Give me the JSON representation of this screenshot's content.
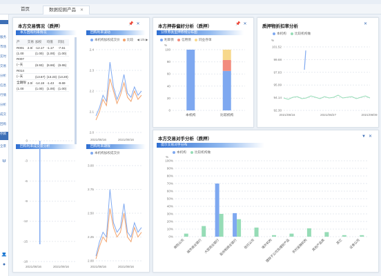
{
  "top_label": "",
  "tabs": [
    {
      "label": "首页"
    },
    {
      "label": "数据挖掘产品"
    }
  ],
  "sidebar": {
    "items": [
      "服务",
      "市场",
      "实时",
      "交易",
      "分析",
      "信息",
      "行情",
      "分析",
      "成交",
      "回购",
      "存款",
      "全景"
    ]
  },
  "panel1": {
    "title": "本方交易情况（质押）",
    "sub1": "本方回购利率情况",
    "sub2": "回购利率波动",
    "sub3": "回购利率成交量分析",
    "sub4": "回购利率期限",
    "table": {
      "header": [
        "产",
        "交易",
        "加权",
        "均值",
        "同比"
      ],
      "rows": [
        [
          "R001",
          "2.0/",
          "-12.17",
          "-1.17",
          "-7.61"
        ],
        [
          "(1.00",
          "",
          "(1.00)",
          "(1.00)",
          "(1.00)"
        ],
        [
          "R007",
          "",
          "",
          "",
          ""
        ],
        [
          "(--天",
          "",
          "(6.93)",
          "(6.66)",
          "(6.65)"
        ],
        [
          "R014",
          "",
          "",
          "",
          ""
        ],
        [
          "(--天",
          "",
          "(13.67)",
          "(13.23)",
          "(13.20)"
        ],
        [
          "全期限",
          "2.0/",
          "-14.18",
          "-1.43",
          "-9.69"
        ],
        [
          "(1.00",
          "",
          "(1.00)",
          "(1.00)",
          "(1.00)"
        ]
      ]
    },
    "legend_a": "本机构加权成交价",
    "legend_b": "比较",
    "page": "1/5",
    "chart_a_yticks": [
      "2.4",
      "2.3",
      "2.2",
      "2.1",
      "2.0"
    ],
    "chart_b_yticks": [
      "3.00",
      "2.75",
      "2.50",
      "2.25",
      "2.00"
    ],
    "left_yticks": [
      "0",
      "-3",
      "-6",
      "-9",
      "-12",
      "-15",
      "-18"
    ],
    "x_start": "2021/08/16",
    "x_end": "2021/09/16"
  },
  "panel2": {
    "title": "本方押券偏好分析（质押）",
    "sub": "分债券类型押券物分布图",
    "legend": [
      "利率债",
      "信用债",
      "同业存单"
    ],
    "unit": "%",
    "yticks": [
      "100",
      "80",
      "60",
      "40",
      "20",
      "0"
    ],
    "categories": [
      "本机构",
      "比较机构"
    ]
  },
  "panel3": {
    "title": "质押物折扣率分析",
    "legend": [
      "本机构",
      "比较机构做"
    ],
    "unit": "%",
    "yticks": [
      "101.52",
      "99.68",
      "97.83",
      "95.99",
      "94.14",
      "92.30"
    ],
    "xticks": [
      "2021/08/16",
      "2021/08/27",
      "2021/09/09"
    ]
  },
  "panel4": {
    "title": "本方交易对手分析（质押）",
    "sub": "提示交易对手分布",
    "legend": [
      "本机构",
      "比较机构做"
    ],
    "unit": "%",
    "yticks": [
      "100%",
      "90%",
      "80%",
      "70%",
      "60%",
      "50%",
      "40%",
      "30%",
      "20%",
      "10%",
      "0%"
    ],
    "categories": [
      "保险公司",
      "城市商业银行",
      "大型商业银行",
      "股份制商业银行",
      "信托公司",
      "境外机构",
      "理财子公司及理财产品",
      "农村金融机构",
      "其他产品类",
      "其它",
      "证券公司"
    ]
  },
  "chart_data": [
    {
      "type": "bar",
      "title": "分债券类型押券物分布图",
      "categories": [
        "本机构",
        "比较机构"
      ],
      "series": [
        {
          "name": "利率债",
          "values": [
            100,
            65
          ]
        },
        {
          "name": "信用债",
          "values": [
            0,
            18
          ]
        },
        {
          "name": "同业存单",
          "values": [
            0,
            17
          ]
        }
      ],
      "ylim": [
        0,
        100
      ],
      "colors": [
        "#7ea8f0",
        "#f28b7d",
        "#f7d88c"
      ]
    },
    {
      "type": "bar",
      "title": "提示交易对手分布",
      "categories": [
        "保险公司",
        "城市商业银行",
        "大型商业银行",
        "股份制商业银行",
        "信托公司",
        "境外机构",
        "理财子公司及理财产品",
        "农村金融机构",
        "其他产品类",
        "其它",
        "证券公司"
      ],
      "series": [
        {
          "name": "本机构",
          "values": [
            0,
            0,
            70,
            31,
            0,
            0,
            0,
            0,
            0,
            0,
            0
          ]
        },
        {
          "name": "比较机构做",
          "values": [
            4,
            14,
            30,
            23,
            12,
            2,
            4,
            11,
            6,
            2,
            2
          ]
        }
      ],
      "ylim": [
        0,
        100
      ],
      "colors": [
        "#7ea8f0",
        "#96dcb6"
      ]
    },
    {
      "type": "line",
      "title": "质押物折扣率分析",
      "x": [
        "2021/08/16",
        "2021/08/27",
        "2021/09/09"
      ],
      "series": [
        {
          "name": "本机构",
          "values": [
            98.2,
            101.0
          ]
        },
        {
          "name": "比较机构做",
          "values": [
            94.1,
            93.9,
            94.2,
            94.3,
            94.0,
            94.1,
            94.4,
            94.2,
            94.0,
            94.3,
            94.1,
            94.2,
            94.5,
            94.1,
            94.2,
            94.3,
            94.0,
            94.2,
            94.4,
            94.1
          ]
        }
      ],
      "ylim": [
        92.3,
        101.52
      ]
    },
    {
      "type": "line",
      "title": "回购利率波动",
      "series": [
        {
          "name": "本机构加权成交价",
          "values": [
            2.08,
            2.12,
            2.18,
            2.15,
            2.34,
            2.22,
            2.16,
            2.2,
            2.28,
            2.19,
            2.17,
            2.22,
            2.18,
            2.2
          ]
        },
        {
          "name": "比较",
          "values": [
            2.06,
            2.1,
            2.16,
            2.13,
            2.26,
            2.2,
            2.14,
            2.18,
            2.24,
            2.17,
            2.15,
            2.2,
            2.16,
            2.18
          ]
        }
      ],
      "ylim": [
        2.0,
        2.4
      ]
    },
    {
      "type": "line",
      "title": "回购利率期限",
      "series": [
        {
          "name": "本机构加权成交价",
          "values": [
            2.05,
            2.2,
            2.3,
            2.25,
            2.75,
            2.4,
            2.3,
            2.35,
            2.6,
            2.3,
            2.25,
            2.4,
            2.3,
            2.35
          ]
        },
        {
          "name": "比较",
          "values": [
            2.02,
            2.15,
            2.25,
            2.2,
            2.55,
            2.35,
            2.25,
            2.3,
            2.5,
            2.25,
            2.2,
            2.35,
            2.25,
            2.3
          ]
        }
      ],
      "ylim": [
        2.0,
        3.0
      ]
    }
  ]
}
